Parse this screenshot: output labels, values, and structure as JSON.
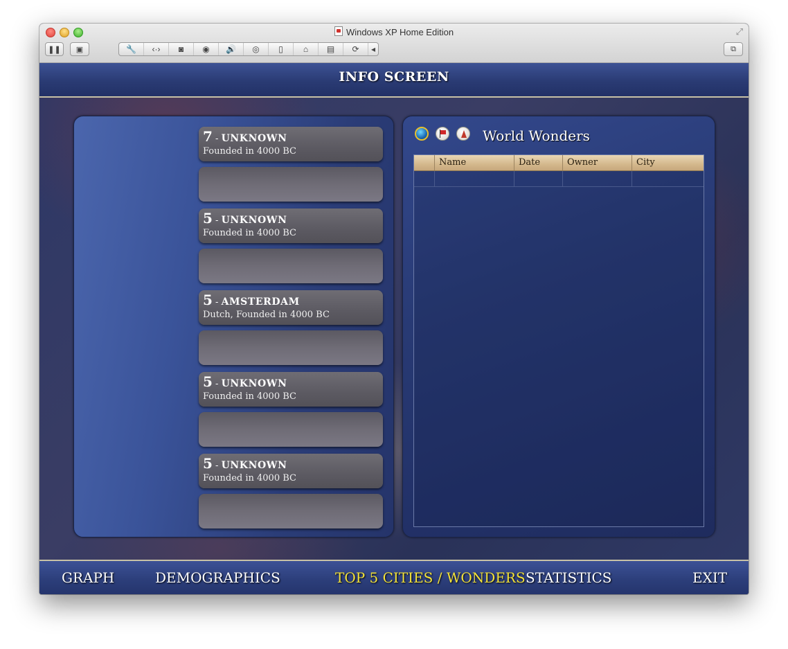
{
  "window": {
    "title": "Windows XP Home Edition"
  },
  "toolbar": {
    "pause_icon": "pause-icon",
    "screenshot_icon": "screen-icon",
    "group_icons": [
      "wrench-icon",
      "network-icon",
      "disk-icon",
      "camera-icon",
      "speaker-icon",
      "cd-icon",
      "mouse-icon",
      "usb-icon",
      "drive-icon",
      "sync-icon",
      "chevron-left-icon"
    ],
    "restore_icon": "window-restore-icon"
  },
  "screen": {
    "title": "INFO SCREEN"
  },
  "cities": [
    {
      "size": "7",
      "name": "UNKNOWN",
      "subtitle": "Founded in 4000 BC"
    },
    {
      "size": "5",
      "name": "UNKNOWN",
      "subtitle": "Founded in 4000 BC"
    },
    {
      "size": "5",
      "name": "AMSTERDAM",
      "subtitle": "Dutch, Founded in 4000 BC"
    },
    {
      "size": "5",
      "name": "UNKNOWN",
      "subtitle": "Founded in 4000 BC"
    },
    {
      "size": "5",
      "name": "UNKNOWN",
      "subtitle": "Founded in 4000 BC"
    }
  ],
  "city_separator": " - ",
  "wonders": {
    "title": "World Wonders",
    "columns": [
      "",
      "Name",
      "Date",
      "Owner",
      "City"
    ],
    "rows": [
      [
        "",
        "",
        "",
        "",
        ""
      ]
    ]
  },
  "footer": {
    "graph": "GRAPH",
    "demographics": "DEMOGRAPHICS",
    "top5": "TOP 5 CITIES / WONDERS",
    "statistics": "STATISTICS",
    "exit": "EXIT"
  },
  "colors": {
    "active_nav": "#f3e23a",
    "panel_blue": "#2b3d78",
    "card_gray": "#5c5a62"
  }
}
